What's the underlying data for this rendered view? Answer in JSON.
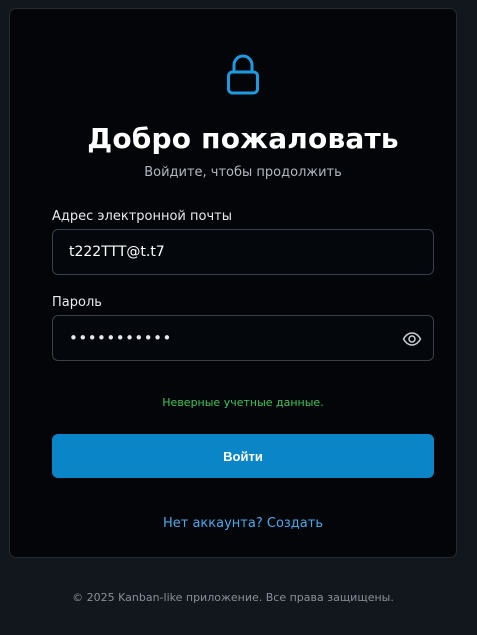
{
  "header": {
    "title": "Добро пожаловать",
    "subtitle": "Войдите, чтобы продолжить"
  },
  "form": {
    "email_label": "Адрес электронной почты",
    "email_value": "t222TTT@t.t7",
    "password_label": "Пароль",
    "password_masked": "•••••••••••",
    "error_message": "Неверные учетные данные.",
    "submit_label": "Войти",
    "signup_link": "Нет аккаунта? Создать"
  },
  "footer": {
    "copyright": "© 2025 Kanban-like приложение. Все права защищены."
  },
  "icons": {
    "lock": "lock-icon",
    "eye": "eye-icon"
  },
  "colors": {
    "accent": "#0a85c7",
    "link": "#4aa8e8",
    "error": "#3fc55b",
    "icon": "#1e9be0"
  }
}
